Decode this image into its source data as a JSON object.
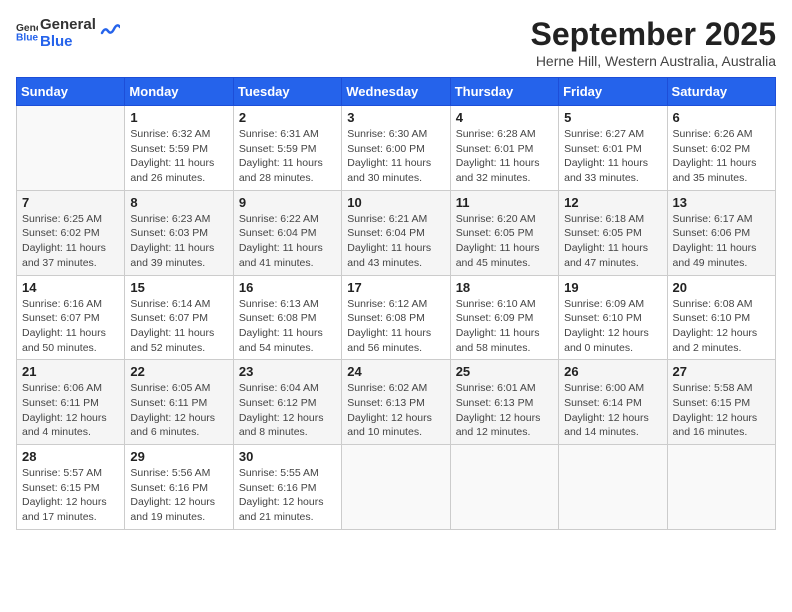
{
  "header": {
    "logo_line1": "General",
    "logo_line2": "Blue",
    "month": "September 2025",
    "location": "Herne Hill, Western Australia, Australia"
  },
  "weekdays": [
    "Sunday",
    "Monday",
    "Tuesday",
    "Wednesday",
    "Thursday",
    "Friday",
    "Saturday"
  ],
  "weeks": [
    [
      {
        "day": "",
        "info": ""
      },
      {
        "day": "1",
        "info": "Sunrise: 6:32 AM\nSunset: 5:59 PM\nDaylight: 11 hours\nand 26 minutes."
      },
      {
        "day": "2",
        "info": "Sunrise: 6:31 AM\nSunset: 5:59 PM\nDaylight: 11 hours\nand 28 minutes."
      },
      {
        "day": "3",
        "info": "Sunrise: 6:30 AM\nSunset: 6:00 PM\nDaylight: 11 hours\nand 30 minutes."
      },
      {
        "day": "4",
        "info": "Sunrise: 6:28 AM\nSunset: 6:01 PM\nDaylight: 11 hours\nand 32 minutes."
      },
      {
        "day": "5",
        "info": "Sunrise: 6:27 AM\nSunset: 6:01 PM\nDaylight: 11 hours\nand 33 minutes."
      },
      {
        "day": "6",
        "info": "Sunrise: 6:26 AM\nSunset: 6:02 PM\nDaylight: 11 hours\nand 35 minutes."
      }
    ],
    [
      {
        "day": "7",
        "info": "Sunrise: 6:25 AM\nSunset: 6:02 PM\nDaylight: 11 hours\nand 37 minutes."
      },
      {
        "day": "8",
        "info": "Sunrise: 6:23 AM\nSunset: 6:03 PM\nDaylight: 11 hours\nand 39 minutes."
      },
      {
        "day": "9",
        "info": "Sunrise: 6:22 AM\nSunset: 6:04 PM\nDaylight: 11 hours\nand 41 minutes."
      },
      {
        "day": "10",
        "info": "Sunrise: 6:21 AM\nSunset: 6:04 PM\nDaylight: 11 hours\nand 43 minutes."
      },
      {
        "day": "11",
        "info": "Sunrise: 6:20 AM\nSunset: 6:05 PM\nDaylight: 11 hours\nand 45 minutes."
      },
      {
        "day": "12",
        "info": "Sunrise: 6:18 AM\nSunset: 6:05 PM\nDaylight: 11 hours\nand 47 minutes."
      },
      {
        "day": "13",
        "info": "Sunrise: 6:17 AM\nSunset: 6:06 PM\nDaylight: 11 hours\nand 49 minutes."
      }
    ],
    [
      {
        "day": "14",
        "info": "Sunrise: 6:16 AM\nSunset: 6:07 PM\nDaylight: 11 hours\nand 50 minutes."
      },
      {
        "day": "15",
        "info": "Sunrise: 6:14 AM\nSunset: 6:07 PM\nDaylight: 11 hours\nand 52 minutes."
      },
      {
        "day": "16",
        "info": "Sunrise: 6:13 AM\nSunset: 6:08 PM\nDaylight: 11 hours\nand 54 minutes."
      },
      {
        "day": "17",
        "info": "Sunrise: 6:12 AM\nSunset: 6:08 PM\nDaylight: 11 hours\nand 56 minutes."
      },
      {
        "day": "18",
        "info": "Sunrise: 6:10 AM\nSunset: 6:09 PM\nDaylight: 11 hours\nand 58 minutes."
      },
      {
        "day": "19",
        "info": "Sunrise: 6:09 AM\nSunset: 6:10 PM\nDaylight: 12 hours\nand 0 minutes."
      },
      {
        "day": "20",
        "info": "Sunrise: 6:08 AM\nSunset: 6:10 PM\nDaylight: 12 hours\nand 2 minutes."
      }
    ],
    [
      {
        "day": "21",
        "info": "Sunrise: 6:06 AM\nSunset: 6:11 PM\nDaylight: 12 hours\nand 4 minutes."
      },
      {
        "day": "22",
        "info": "Sunrise: 6:05 AM\nSunset: 6:11 PM\nDaylight: 12 hours\nand 6 minutes."
      },
      {
        "day": "23",
        "info": "Sunrise: 6:04 AM\nSunset: 6:12 PM\nDaylight: 12 hours\nand 8 minutes."
      },
      {
        "day": "24",
        "info": "Sunrise: 6:02 AM\nSunset: 6:13 PM\nDaylight: 12 hours\nand 10 minutes."
      },
      {
        "day": "25",
        "info": "Sunrise: 6:01 AM\nSunset: 6:13 PM\nDaylight: 12 hours\nand 12 minutes."
      },
      {
        "day": "26",
        "info": "Sunrise: 6:00 AM\nSunset: 6:14 PM\nDaylight: 12 hours\nand 14 minutes."
      },
      {
        "day": "27",
        "info": "Sunrise: 5:58 AM\nSunset: 6:15 PM\nDaylight: 12 hours\nand 16 minutes."
      }
    ],
    [
      {
        "day": "28",
        "info": "Sunrise: 5:57 AM\nSunset: 6:15 PM\nDaylight: 12 hours\nand 17 minutes."
      },
      {
        "day": "29",
        "info": "Sunrise: 5:56 AM\nSunset: 6:16 PM\nDaylight: 12 hours\nand 19 minutes."
      },
      {
        "day": "30",
        "info": "Sunrise: 5:55 AM\nSunset: 6:16 PM\nDaylight: 12 hours\nand 21 minutes."
      },
      {
        "day": "",
        "info": ""
      },
      {
        "day": "",
        "info": ""
      },
      {
        "day": "",
        "info": ""
      },
      {
        "day": "",
        "info": ""
      }
    ]
  ]
}
